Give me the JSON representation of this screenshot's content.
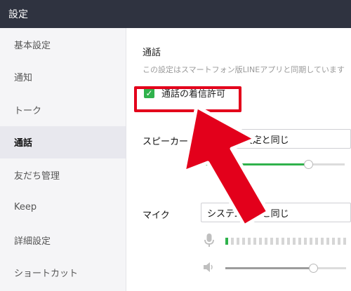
{
  "window": {
    "title": "設定"
  },
  "sidebar": {
    "items": [
      {
        "label": "基本設定",
        "active": false
      },
      {
        "label": "通知",
        "active": false
      },
      {
        "label": "トーク",
        "active": false
      },
      {
        "label": "通話",
        "active": true
      },
      {
        "label": "友だち管理",
        "active": false
      },
      {
        "label": "Keep",
        "active": false
      },
      {
        "label": "詳細設定",
        "active": false
      },
      {
        "label": "ショートカット",
        "active": false
      }
    ]
  },
  "main": {
    "section_title": "通話",
    "section_note": "この設定はスマートフォン版LINEアプリと同期しています",
    "incoming_call_checkbox": {
      "label": "通話の着信許可",
      "checked": true
    },
    "speaker": {
      "label": "スピーカー",
      "selected": "システム設定と同じ",
      "volume": 0.72
    },
    "mic": {
      "label": "マイク",
      "selected": "システム設定と同じ",
      "input_level": 0.05,
      "volume": 0.72
    }
  },
  "colors": {
    "accent": "#2fb24c",
    "highlight": "#e3001b",
    "titlebar": "#2f3340"
  },
  "icons": {
    "checkbox": "check-icon",
    "mic": "microphone-icon",
    "speaker": "speaker-icon",
    "annotation": "red-arrow-icon"
  }
}
